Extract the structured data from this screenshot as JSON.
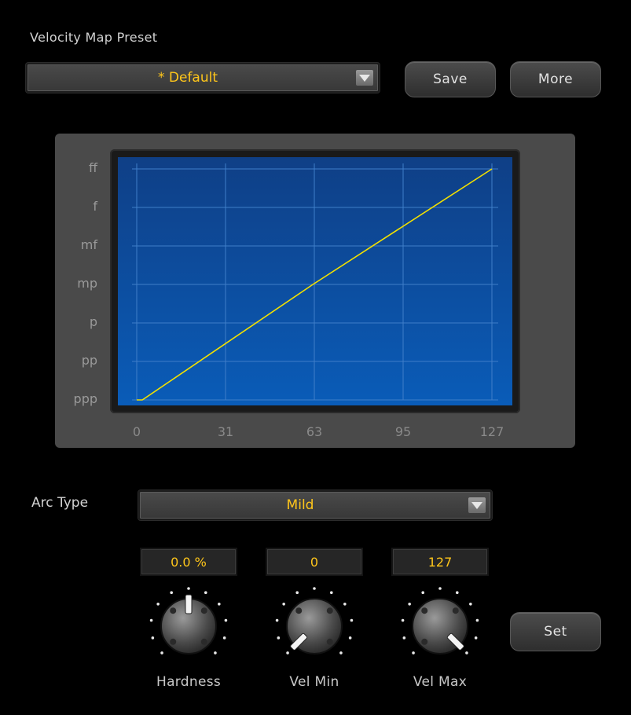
{
  "preset": {
    "label": "Velocity Map Preset",
    "value": "* Default",
    "save_label": "Save",
    "more_label": "More"
  },
  "chart_data": {
    "type": "line",
    "title": "",
    "xlabel": "",
    "ylabel": "",
    "x_ticks": [
      "0",
      "31",
      "63",
      "95",
      "127"
    ],
    "y_ticks": [
      "ppp",
      "pp",
      "p",
      "mp",
      "mf",
      "f",
      "ff"
    ],
    "xlim": [
      0,
      127
    ],
    "ylim": [
      0,
      6
    ],
    "grid": true,
    "series": [
      {
        "x": [
          0,
          2,
          63,
          127
        ],
        "y": [
          0,
          0,
          3,
          6
        ]
      }
    ]
  },
  "arc_type": {
    "label": "Arc Type",
    "value": "Mild"
  },
  "knobs": [
    {
      "label": "Hardness",
      "display": "0.0 %",
      "level": 0.5
    },
    {
      "label": "Vel Min",
      "display": "0",
      "level": 0.0
    },
    {
      "label": "Vel Max",
      "display": "127",
      "level": 1.0
    }
  ],
  "set_label": "Set",
  "colors": {
    "accent": "#ffc61a",
    "graph_bg_top": "#0f3f86",
    "graph_bg_bottom": "#0a5cb8",
    "curve": "#f2e000"
  }
}
